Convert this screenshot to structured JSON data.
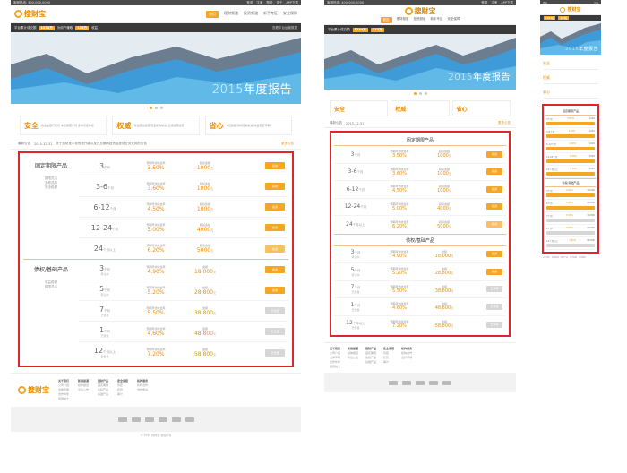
{
  "brand": {
    "name": "搜财宝"
  },
  "topbar": {
    "phone": "客服热线: 400-000-0000",
    "links": [
      "登录",
      "注册",
      "帮助",
      "关于",
      "APP下载"
    ]
  },
  "nav": {
    "items": [
      "首页",
      "理财频道",
      "投资频道",
      "新手专区",
      "安全保障"
    ],
    "active_index": 0
  },
  "stats": {
    "prefix": "平台累计成交额",
    "amount": "1234万",
    "mid": "为用户赚取",
    "earn": "123万",
    "suffix": "收益",
    "right": "查看平台运营数据"
  },
  "banner": {
    "title": "2015年度报告"
  },
  "features": [
    {
      "title": "安全",
      "desc": "资金由银行托管\n本息保障计划\n多重风控体系"
    },
    {
      "title": "权威",
      "desc": "专业团队运营\n知名机构投资\n合规透明运营"
    },
    {
      "title": "省心",
      "desc": "1元起投\n随时随地投资\n收益稳定可期"
    }
  ],
  "notice": {
    "label": "最新公告",
    "date": "2015-12-31",
    "text": "关于搜财宝平台系统升级以及元旦期间投资及提现业务安排的公告",
    "more": "更多公告"
  },
  "fixed": {
    "title": "固定期限产品",
    "desc": [
      "期限灵活",
      "多种选择",
      "安全稳健"
    ],
    "rate_label": "预期年化收益率",
    "amount_label": "起投金额",
    "rows": [
      {
        "term": "3",
        "unit": "个月",
        "rate": "3.50%",
        "amount": "1000",
        "amount_unit": "元",
        "btn": "投资"
      },
      {
        "term": "3-6",
        "unit": "个月",
        "rate": "3.60%",
        "amount": "1000",
        "amount_unit": "元",
        "btn": "投资"
      },
      {
        "term": "6-12",
        "unit": "个月",
        "rate": "4.50%",
        "amount": "1000",
        "amount_unit": "元",
        "btn": "投资"
      },
      {
        "term": "12-24",
        "unit": "个月",
        "rate": "5.00%",
        "amount": "4000",
        "amount_unit": "元",
        "btn": "投资"
      },
      {
        "term": "24",
        "unit": "个月以上",
        "rate": "6.20%",
        "amount": "5000",
        "amount_unit": "元",
        "btn": "投资"
      }
    ]
  },
  "bond": {
    "title": "债权/基础产品",
    "desc": [
      "收益稳健",
      "期限灵活"
    ],
    "rate_label": "预期年化收益率",
    "amount_label": "金额",
    "rows": [
      {
        "term": "3",
        "unit": "个月",
        "sub": "转让中",
        "rate": "4.90%",
        "amount": "18,000",
        "amount_unit": "元",
        "btn": "投资",
        "state": "active"
      },
      {
        "term": "5",
        "unit": "个月",
        "sub": "转让中",
        "rate": "5.20%",
        "amount": "28,800",
        "amount_unit": "元",
        "btn": "投资",
        "state": "active"
      },
      {
        "term": "7",
        "unit": "个月",
        "sub": "已售罄",
        "rate": "5.50%",
        "amount": "38,800",
        "amount_unit": "元",
        "btn": "已售罄",
        "state": "soldout"
      },
      {
        "term": "1",
        "unit": "个月",
        "sub": "已售罄",
        "rate": "4.60%",
        "amount": "48,800",
        "amount_unit": "元",
        "btn": "已售罄",
        "state": "soldout"
      },
      {
        "term": "12",
        "unit": "个月以上",
        "sub": "已售罄",
        "rate": "7.20%",
        "amount": "58,800",
        "amount_unit": "元",
        "btn": "已售罄",
        "state": "soldout"
      }
    ]
  },
  "footer": {
    "columns": [
      {
        "head": "关于我们",
        "items": [
          "公司介绍",
          "法律声明",
          "合作伙伴",
          "招贤纳士"
        ]
      },
      {
        "head": "新闻报道",
        "items": [
          "媒体报道",
          "平台公告"
        ]
      },
      {
        "head": "理财产品",
        "items": [
          "固定期限",
          "债权产品",
          "基础产品"
        ]
      },
      {
        "head": "安全保障",
        "items": [
          "风控",
          "托管",
          "审计"
        ]
      },
      {
        "head": "机构服务",
        "items": [
          "机构合作",
          "合作申请"
        ]
      }
    ],
    "copyright": "© 2015 搜财宝 版权所有"
  }
}
